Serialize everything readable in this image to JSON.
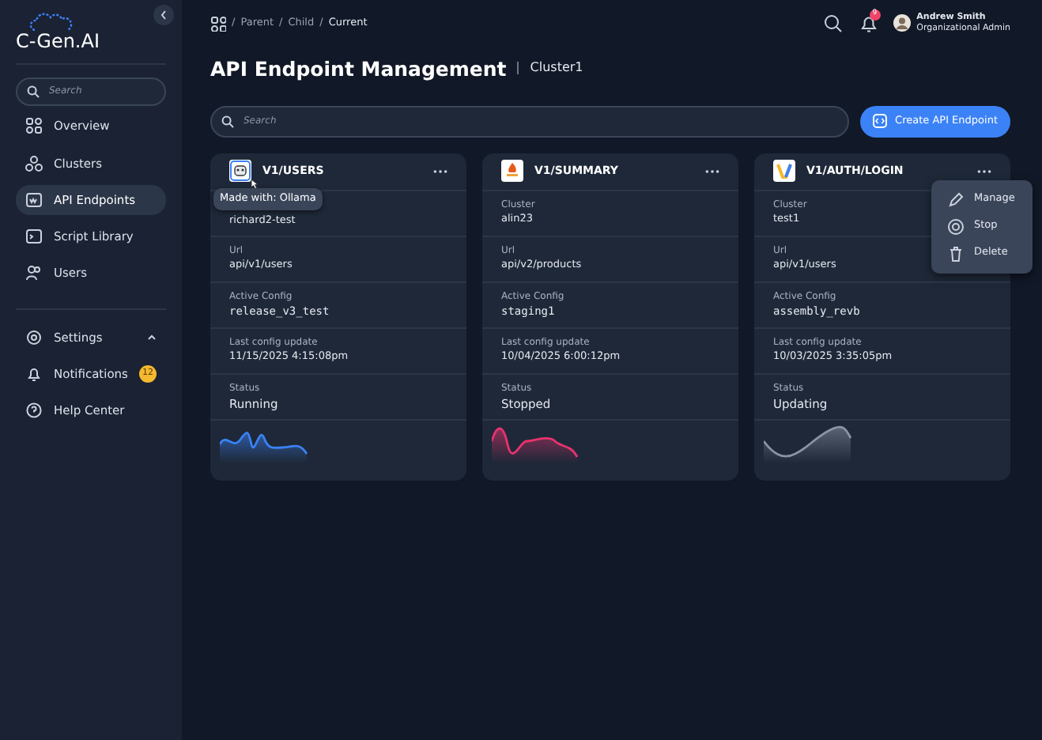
{
  "sidebar": {
    "logo": "C-Gen.AI",
    "search": {
      "placeholder": "Search"
    },
    "items": [
      {
        "label": "Overview",
        "selected": false
      },
      {
        "label": "Clusters",
        "selected": false
      },
      {
        "label": "API Endpoints",
        "selected": true
      },
      {
        "label": "Script Library",
        "selected": false
      },
      {
        "label": "Users",
        "selected": false
      }
    ],
    "bottom_items": [
      {
        "label": "Settings",
        "expanded": true
      },
      {
        "label": "Notifications",
        "badge": "12"
      },
      {
        "label": "Help Center"
      }
    ]
  },
  "breadcrumb": {
    "separator": "/",
    "items": [
      "Parent",
      "Child",
      "Current"
    ]
  },
  "header": {
    "notification_badge": "9",
    "user_name": "Andrew Smith",
    "user_role": "Organizational Admin"
  },
  "page_title": "API Endpoint Management",
  "cluster": "Cluster1",
  "search": {
    "placeholder": "Search"
  },
  "create_button": "Create API Endpoint",
  "cards": [
    {
      "title": "V1/USERS",
      "tooltip": "Made with: Ollama",
      "fields": [
        {
          "value": "richard2-test"
        },
        {
          "label": "Url",
          "value": "api/v1/users"
        },
        {
          "label": "Active Config",
          "value": "release_v3_test"
        },
        {
          "label": "Last config update",
          "value": "11/15/2025  4:15:08pm"
        },
        {
          "label": "Status",
          "value": "Running"
        }
      ],
      "sparkline": {
        "color": "#3b82f6"
      }
    },
    {
      "title": "V1/SUMMARY",
      "fields": [
        {
          "label": "Cluster",
          "value": "alin23"
        },
        {
          "label": "Url",
          "value": "api/v2/products"
        },
        {
          "label": "Active Config",
          "value": "staging1"
        },
        {
          "label": "Last config update",
          "value": "10/04/2025  6:00:12pm"
        },
        {
          "label": "Status",
          "value": "Stopped"
        }
      ],
      "sparkline": {
        "color": "#e8336d"
      }
    },
    {
      "title": "V1/AUTH/LOGIN",
      "fields": [
        {
          "label": "Cluster",
          "value": "test1"
        },
        {
          "label": "Url",
          "value": "api/v1/users"
        },
        {
          "label": "Active Config",
          "value": "assembly_revb"
        },
        {
          "label": "Last config update",
          "value": "10/03/2025  3:35:05pm"
        },
        {
          "label": "Status",
          "value": "Updating"
        }
      ],
      "sparkline": {
        "color": "#8a94a6"
      },
      "menu": [
        {
          "label": "Manage",
          "kind": "edit"
        },
        {
          "label": "Stop",
          "kind": "stop"
        },
        {
          "label": "Delete",
          "kind": "delete"
        }
      ]
    }
  ]
}
